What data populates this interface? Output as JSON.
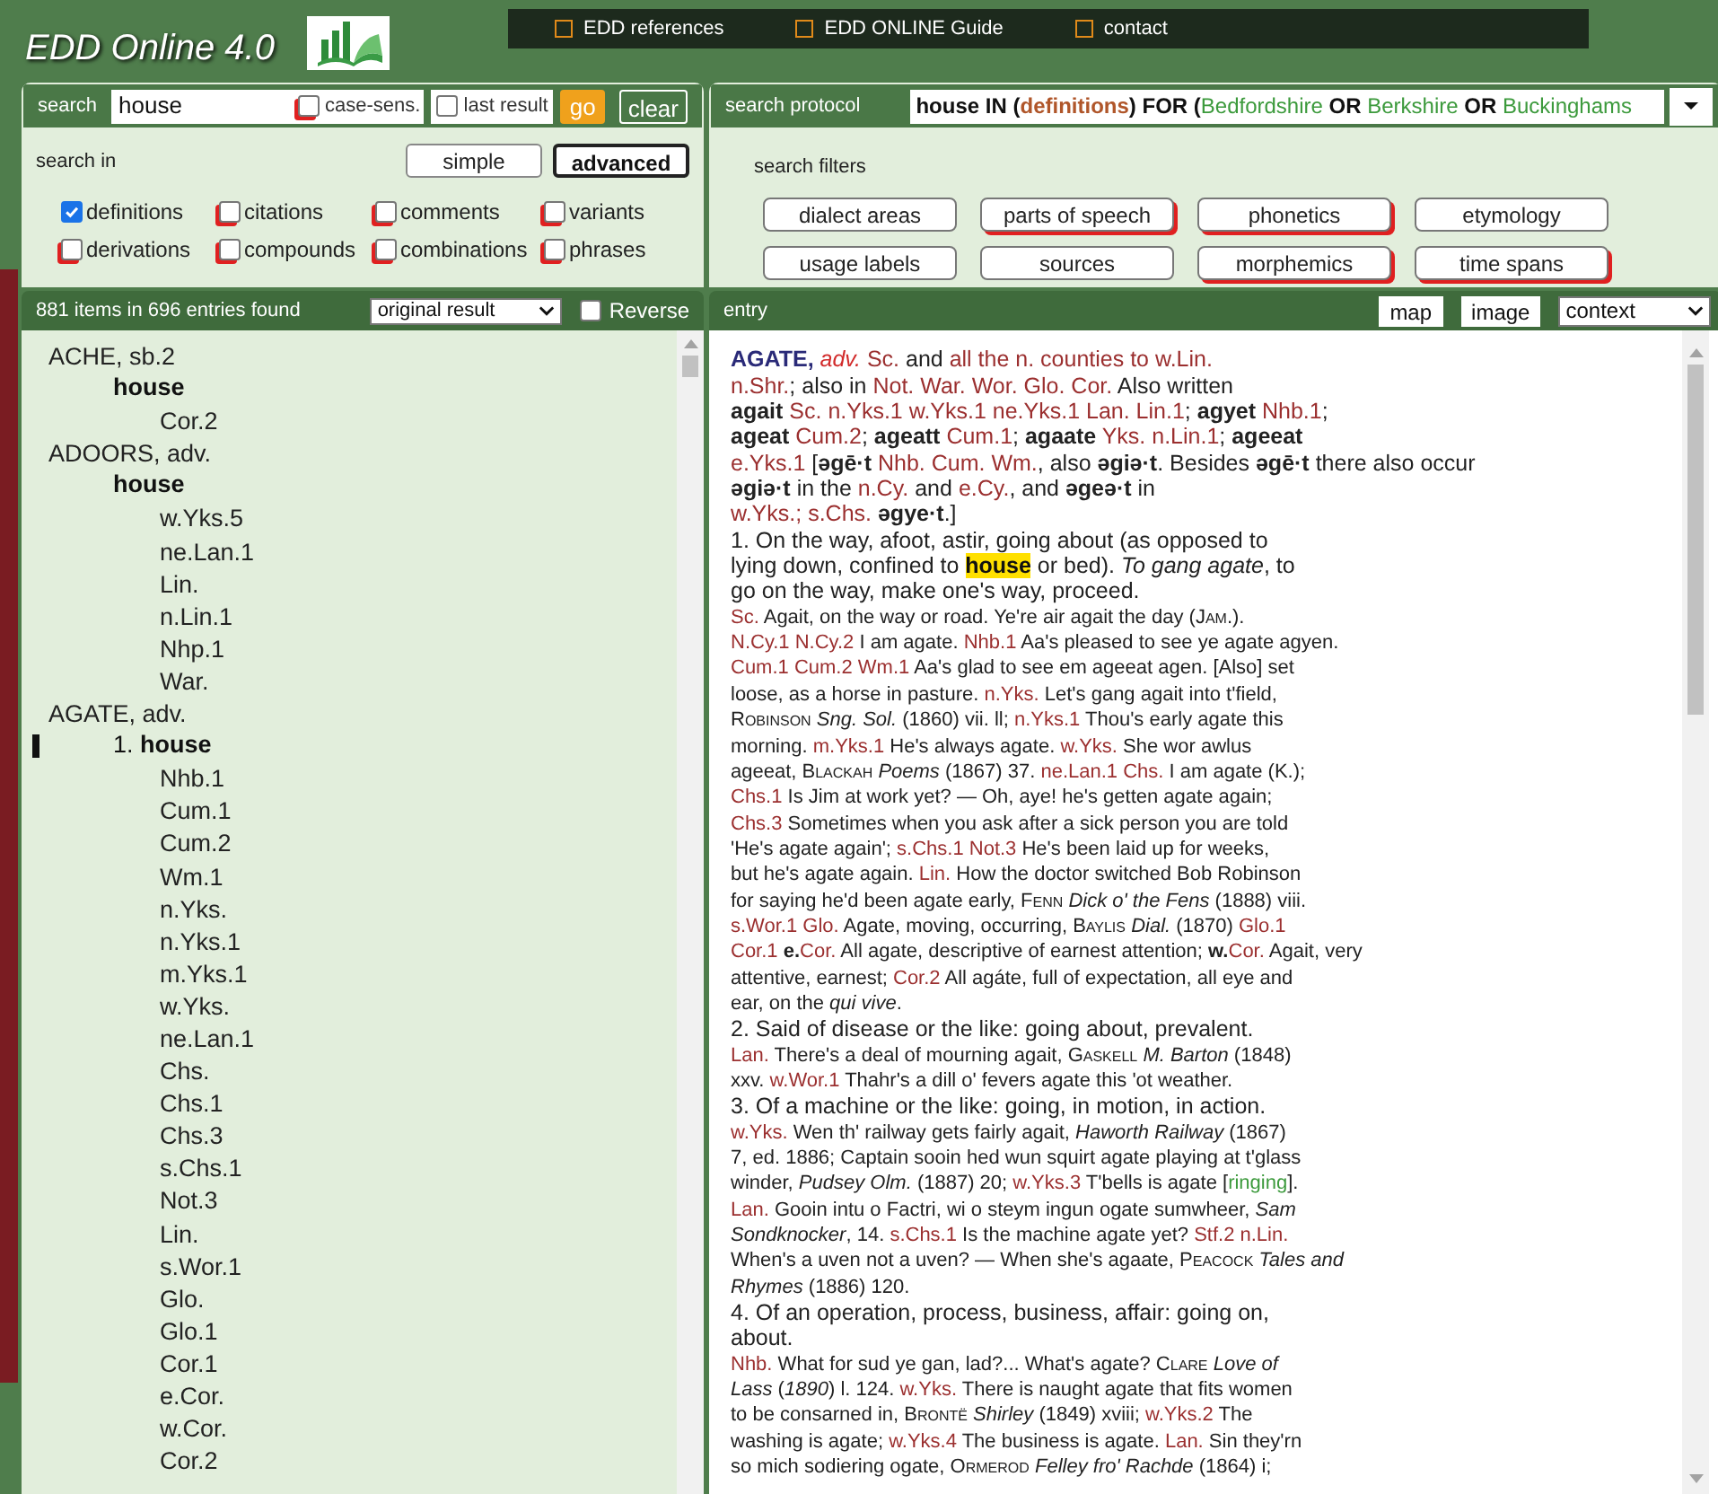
{
  "app": {
    "title": "EDD Online 4.0"
  },
  "top_menu": [
    {
      "label": "EDD references"
    },
    {
      "label": "EDD ONLINE Guide"
    },
    {
      "label": "contact"
    }
  ],
  "search": {
    "label": "search",
    "value": "house",
    "case_sens": {
      "label": "case-sens.",
      "checked": false
    },
    "last_result": {
      "label": "last result",
      "checked": false
    },
    "go": "go",
    "clear": "clear"
  },
  "search_in": {
    "label": "search in",
    "modes": [
      {
        "label": "simple",
        "selected": false
      },
      {
        "label": "advanced",
        "selected": true
      }
    ],
    "options": [
      {
        "label": "definitions",
        "checked": true
      },
      {
        "label": "citations",
        "checked": false
      },
      {
        "label": "comments",
        "checked": false
      },
      {
        "label": "variants",
        "checked": false
      },
      {
        "label": "derivations",
        "checked": false
      },
      {
        "label": "compounds",
        "checked": false
      },
      {
        "label": "combinations",
        "checked": false
      },
      {
        "label": "phrases",
        "checked": false
      }
    ]
  },
  "protocol": {
    "label": "search protocol",
    "segs": [
      {
        "kind": "b",
        "text": "house IN ("
      },
      {
        "kind": "o",
        "text": "definitions"
      },
      {
        "kind": "b",
        "text": ") FOR ("
      },
      {
        "kind": "g",
        "text": "Bedfordshire"
      },
      {
        "kind": "b",
        "text": " OR "
      },
      {
        "kind": "g",
        "text": "Berkshire"
      },
      {
        "kind": "b",
        "text": " OR "
      },
      {
        "kind": "g",
        "text": "Buckinghams"
      }
    ]
  },
  "filters": {
    "label": "search filters",
    "buttons": [
      {
        "label": "dialect areas",
        "active": false
      },
      {
        "label": "parts of speech",
        "active": true
      },
      {
        "label": "phonetics",
        "active": true
      },
      {
        "label": "etymology",
        "active": false
      },
      {
        "label": "usage labels",
        "active": false
      },
      {
        "label": "sources",
        "active": false
      },
      {
        "label": "morphemics",
        "active": true
      },
      {
        "label": "time spans",
        "active": true
      }
    ]
  },
  "results": {
    "summary": "881 items in 696 entries found",
    "order": "original result",
    "reverse": {
      "label": "Reverse",
      "checked": false
    }
  },
  "tree": [
    {
      "label": "ACHE, sb.2",
      "children": [
        {
          "label": "house",
          "selected": false,
          "children": [
            {
              "label": "Cor.2"
            }
          ]
        }
      ]
    },
    {
      "label": "ADOORS, adv.",
      "children": [
        {
          "label": "house",
          "selected": false,
          "children": [
            {
              "label": "w.Yks.5"
            },
            {
              "label": "ne.Lan.1"
            },
            {
              "label": "Lin."
            },
            {
              "label": "n.Lin.1"
            },
            {
              "label": "Nhp.1"
            },
            {
              "label": "War."
            }
          ]
        }
      ]
    },
    {
      "label": "AGATE, adv.",
      "children": [
        {
          "number": "1.",
          "label": "house",
          "selected": true,
          "children": [
            {
              "label": "Nhb.1"
            },
            {
              "label": "Cum.1"
            },
            {
              "label": "Cum.2"
            },
            {
              "label": "Wm.1"
            },
            {
              "label": "n.Yks."
            },
            {
              "label": "n.Yks.1"
            },
            {
              "label": "m.Yks.1"
            },
            {
              "label": "w.Yks."
            },
            {
              "label": "ne.Lan.1"
            },
            {
              "label": "Chs."
            },
            {
              "label": "Chs.1"
            },
            {
              "label": "Chs.3"
            },
            {
              "label": "s.Chs.1"
            },
            {
              "label": "Not.3"
            },
            {
              "label": "Lin."
            },
            {
              "label": "s.Wor.1"
            },
            {
              "label": "Glo."
            },
            {
              "label": "Glo.1"
            },
            {
              "label": "Cor.1"
            },
            {
              "label": "e.Cor."
            },
            {
              "label": "w.Cor."
            },
            {
              "label": "Cor.2"
            }
          ]
        }
      ]
    }
  ],
  "entry_bar": {
    "label": "entry",
    "buttons": [
      "map",
      "image"
    ],
    "view": "context"
  },
  "entry": [
    {
      "kind": "sense",
      "segs": [
        {
          "kind": "h",
          "text": "AGATE,"
        },
        {
          "kind": "a",
          "text": " adv."
        },
        {
          "kind": "r",
          "text": " Sc."
        },
        {
          "kind": "n",
          "text": " and "
        },
        {
          "kind": "r",
          "text": "all the n. counties to w.Lin."
        }
      ]
    },
    {
      "kind": "sense",
      "segs": [
        {
          "kind": "r",
          "text": "n.Shr."
        },
        {
          "kind": "n",
          "text": "; also in "
        },
        {
          "kind": "r",
          "text": "Not. War. Wor. Glo. Cor."
        },
        {
          "kind": "n",
          "text": " Also written"
        }
      ]
    },
    {
      "kind": "sense",
      "segs": [
        {
          "kind": "n",
          "text": "**agait**"
        },
        {
          "kind": "r",
          "text": " Sc. n.Yks.1 w.Yks.1 ne.Yks.1 Lan. Lin.1"
        },
        {
          "kind": "n",
          "text": "; **agyet**"
        },
        {
          "kind": "r",
          "text": " Nhb.1"
        },
        {
          "kind": "n",
          "text": ";"
        }
      ]
    },
    {
      "kind": "sense",
      "segs": [
        {
          "kind": "n",
          "text": "**ageat**"
        },
        {
          "kind": "r",
          "text": " Cum.2"
        },
        {
          "kind": "n",
          "text": "; **ageatt**"
        },
        {
          "kind": "r",
          "text": " Cum.1"
        },
        {
          "kind": "n",
          "text": "; **agaate**"
        },
        {
          "kind": "r",
          "text": " Yks. n.Lin.1"
        },
        {
          "kind": "n",
          "text": "; **ageeat**"
        }
      ]
    },
    {
      "kind": "sense",
      "segs": [
        {
          "kind": "r",
          "text": "e.Yks.1"
        },
        {
          "kind": "n",
          "text": " [**əgē·t**"
        },
        {
          "kind": "r",
          "text": " Nhb. Cum. Wm."
        },
        {
          "kind": "n",
          "text": ", also **əgiə·t**. Besides **əgē·t** there also occur"
        }
      ]
    },
    {
      "kind": "sense",
      "segs": [
        {
          "kind": "n",
          "text": "**əgiə·t** in the "
        },
        {
          "kind": "r",
          "text": "n.Cy."
        },
        {
          "kind": "n",
          "text": " and "
        },
        {
          "kind": "r",
          "text": "e.Cy."
        },
        {
          "kind": "n",
          "text": ", and **əgeə·t** in"
        }
      ]
    },
    {
      "kind": "sense",
      "segs": [
        {
          "kind": "r",
          "text": "w.Yks.; s.Chs."
        },
        {
          "kind": "n",
          "text": " **əgye·t**.]"
        }
      ]
    },
    {
      "kind": "sense",
      "segs": [
        {
          "kind": "n",
          "text": "1. On the way, afoot, astir, going about (as opposed to"
        }
      ]
    },
    {
      "kind": "sense",
      "segs": [
        {
          "kind": "n",
          "text": "lying down, confined to "
        },
        {
          "kind": "hl",
          "text": "house"
        },
        {
          "kind": "n",
          "text": " or bed). *To gang agate*, to"
        }
      ]
    },
    {
      "kind": "sense",
      "segs": [
        {
          "kind": "n",
          "text": "go on the way, make one's way, proceed."
        }
      ]
    },
    {
      "kind": "quote",
      "segs": [
        {
          "kind": "r",
          "text": "Sc."
        },
        {
          "kind": "n",
          "text": " Agait, on the way or road. Ye're air agait the day ("
        },
        {
          "kind": "sc",
          "text": "Jam."
        },
        {
          "kind": "n",
          "text": ")."
        }
      ]
    },
    {
      "kind": "quote",
      "segs": [
        {
          "kind": "r",
          "text": "N.Cy.1 N.Cy.2"
        },
        {
          "kind": "n",
          "text": " I am agate. "
        },
        {
          "kind": "r",
          "text": "Nhb.1"
        },
        {
          "kind": "n",
          "text": " Aa's pleased to see ye agate agyen."
        }
      ]
    },
    {
      "kind": "quote",
      "segs": [
        {
          "kind": "r",
          "text": "Cum.1 Cum.2 Wm.1"
        },
        {
          "kind": "n",
          "text": " Aa's glad to see em ageeat agen. [Also] set"
        }
      ]
    },
    {
      "kind": "quote",
      "segs": [
        {
          "kind": "n",
          "text": "loose, as a horse in pasture. "
        },
        {
          "kind": "r",
          "text": "n.Yks."
        },
        {
          "kind": "n",
          "text": " Let's gang agait into t'field,"
        }
      ]
    },
    {
      "kind": "quote",
      "segs": [
        {
          "kind": "sc",
          "text": "Robinson"
        },
        {
          "kind": "n",
          "text": " *Sng. Sol.* (1860) vii. ll; "
        },
        {
          "kind": "r",
          "text": "n.Yks.1"
        },
        {
          "kind": "n",
          "text": " Thou's early agate this"
        }
      ]
    },
    {
      "kind": "quote",
      "segs": [
        {
          "kind": "n",
          "text": "morning. "
        },
        {
          "kind": "r",
          "text": "m.Yks.1"
        },
        {
          "kind": "n",
          "text": " He's always agate. "
        },
        {
          "kind": "r",
          "text": "w.Yks."
        },
        {
          "kind": "n",
          "text": " She wor awlus"
        }
      ]
    },
    {
      "kind": "quote",
      "segs": [
        {
          "kind": "n",
          "text": "ageeat, "
        },
        {
          "kind": "sc",
          "text": "Blackah"
        },
        {
          "kind": "n",
          "text": " *Poems* (1867) 37. "
        },
        {
          "kind": "r",
          "text": "ne.Lan.1 Chs."
        },
        {
          "kind": "n",
          "text": " I am agate (K.);"
        }
      ]
    },
    {
      "kind": "quote",
      "segs": [
        {
          "kind": "r",
          "text": "Chs.1"
        },
        {
          "kind": "n",
          "text": " Is Jim at work yet? — Oh, aye! he's getten agate again;"
        }
      ]
    },
    {
      "kind": "quote",
      "segs": [
        {
          "kind": "r",
          "text": "Chs.3"
        },
        {
          "kind": "n",
          "text": " Sometimes when you ask after a sick person you are told"
        }
      ]
    },
    {
      "kind": "quote",
      "segs": [
        {
          "kind": "n",
          "text": "'He's agate again'; "
        },
        {
          "kind": "r",
          "text": "s.Chs.1 Not.3"
        },
        {
          "kind": "n",
          "text": " He's been laid up for weeks,"
        }
      ]
    },
    {
      "kind": "quote",
      "segs": [
        {
          "kind": "n",
          "text": "but he's agate again. "
        },
        {
          "kind": "r",
          "text": "Lin."
        },
        {
          "kind": "n",
          "text": " How the doctor switched Bob Robinson"
        }
      ]
    },
    {
      "kind": "quote",
      "segs": [
        {
          "kind": "n",
          "text": "for saying he'd been agate early, "
        },
        {
          "kind": "sc",
          "text": "Fenn"
        },
        {
          "kind": "n",
          "text": " *Dick o' the Fens* (1888) viii."
        }
      ]
    },
    {
      "kind": "quote",
      "segs": [
        {
          "kind": "r",
          "text": "s.Wor.1 Glo."
        },
        {
          "kind": "n",
          "text": " Agate, moving, occurring, "
        },
        {
          "kind": "sc",
          "text": "Baylis"
        },
        {
          "kind": "n",
          "text": " *Dial.* (1870) "
        },
        {
          "kind": "r",
          "text": "Glo.1"
        }
      ]
    },
    {
      "kind": "quote",
      "segs": [
        {
          "kind": "r",
          "text": "Cor.1"
        },
        {
          "kind": "n",
          "text": " **e.**"
        },
        {
          "kind": "r",
          "text": "Cor."
        },
        {
          "kind": "n",
          "text": " All agate, descriptive of earnest attention; **w.**"
        },
        {
          "kind": "r",
          "text": "Cor."
        },
        {
          "kind": "n",
          "text": " Agait, very"
        }
      ]
    },
    {
      "kind": "quote",
      "segs": [
        {
          "kind": "n",
          "text": "attentive, earnest; "
        },
        {
          "kind": "r",
          "text": "Cor.2"
        },
        {
          "kind": "n",
          "text": " All agáte, full of expectation, all eye and"
        }
      ]
    },
    {
      "kind": "quote",
      "segs": [
        {
          "kind": "n",
          "text": "ear, on the *qui vive*."
        }
      ]
    },
    {
      "kind": "sense",
      "segs": [
        {
          "kind": "n",
          "text": "2. Said of disease or the like: going about, prevalent."
        }
      ]
    },
    {
      "kind": "quote",
      "segs": [
        {
          "kind": "r",
          "text": "Lan."
        },
        {
          "kind": "n",
          "text": " There's a deal of mourning agait, "
        },
        {
          "kind": "sc",
          "text": "Gaskell"
        },
        {
          "kind": "n",
          "text": " *M. Barton* (1848)"
        }
      ]
    },
    {
      "kind": "quote",
      "segs": [
        {
          "kind": "n",
          "text": "xxv. "
        },
        {
          "kind": "r",
          "text": "w.Wor.1"
        },
        {
          "kind": "n",
          "text": " Thahr's a dill o' fevers agate this 'ot weather."
        }
      ]
    },
    {
      "kind": "sense",
      "segs": [
        {
          "kind": "n",
          "text": "3. Of a machine or the like: going, in motion, in action."
        }
      ]
    },
    {
      "kind": "quote",
      "segs": [
        {
          "kind": "r",
          "text": "w.Yks."
        },
        {
          "kind": "n",
          "text": " Wen th' railway gets fairly agait, *Haworth Railway* (1867)"
        }
      ]
    },
    {
      "kind": "quote",
      "segs": [
        {
          "kind": "n",
          "text": "7, ed. 1886; Captain sooin hed wun squirt agate playing at t'glass"
        }
      ]
    },
    {
      "kind": "quote",
      "segs": [
        {
          "kind": "n",
          "text": "winder, *Pudsey Olm.* (1887) 20; "
        },
        {
          "kind": "r",
          "text": "w.Yks.3"
        },
        {
          "kind": "n",
          "text": " T'bells is agate ["
        },
        {
          "kind": "g",
          "text": "ringing"
        },
        {
          "kind": "n",
          "text": "]."
        }
      ]
    },
    {
      "kind": "quote",
      "segs": [
        {
          "kind": "r",
          "text": "Lan."
        },
        {
          "kind": "n",
          "text": " Gooin intu o Factri, wi o steym ingun ogate sumwheer, *Sam*"
        }
      ]
    },
    {
      "kind": "quote",
      "segs": [
        {
          "kind": "n",
          "text": "*Sondknocker*, 14. "
        },
        {
          "kind": "r",
          "text": "s.Chs.1"
        },
        {
          "kind": "n",
          "text": " Is the machine agate yet? "
        },
        {
          "kind": "r",
          "text": "Stf.2 n.Lin."
        }
      ]
    },
    {
      "kind": "quote",
      "segs": [
        {
          "kind": "n",
          "text": "When's a uven not a uven? — When she's agaate, "
        },
        {
          "kind": "sc",
          "text": "Peacock"
        },
        {
          "kind": "n",
          "text": " *Tales and*"
        }
      ]
    },
    {
      "kind": "quote",
      "segs": [
        {
          "kind": "n",
          "text": "*Rhymes* (1886) 120."
        }
      ]
    },
    {
      "kind": "sense",
      "segs": [
        {
          "kind": "n",
          "text": "4. Of an operation, process, business, affair: going on,"
        }
      ]
    },
    {
      "kind": "sense",
      "segs": [
        {
          "kind": "n",
          "text": "about."
        }
      ]
    },
    {
      "kind": "quote",
      "segs": [
        {
          "kind": "r",
          "text": "Nhb."
        },
        {
          "kind": "n",
          "text": " What for sud ye gan, lad?... What's agate? "
        },
        {
          "kind": "sc",
          "text": "Clare"
        },
        {
          "kind": "n",
          "text": " *Love of*"
        }
      ]
    },
    {
      "kind": "quote",
      "segs": [
        {
          "kind": "n",
          "text": "*Lass* (*1890*) l. 124. "
        },
        {
          "kind": "r",
          "text": "w.Yks."
        },
        {
          "kind": "n",
          "text": " There is naught agate that fits women"
        }
      ]
    },
    {
      "kind": "quote",
      "segs": [
        {
          "kind": "n",
          "text": "to be consarned in, "
        },
        {
          "kind": "sc",
          "text": "Brontë"
        },
        {
          "kind": "n",
          "text": " *Shirley* (1849) xviii; "
        },
        {
          "kind": "r",
          "text": "w.Yks.2"
        },
        {
          "kind": "n",
          "text": " The"
        }
      ]
    },
    {
      "kind": "quote",
      "segs": [
        {
          "kind": "n",
          "text": "washing is agate; "
        },
        {
          "kind": "r",
          "text": "w.Yks.4"
        },
        {
          "kind": "n",
          "text": " The business is agate. "
        },
        {
          "kind": "r",
          "text": "Lan."
        },
        {
          "kind": "n",
          "text": " Sin they'rn"
        }
      ]
    },
    {
      "kind": "quote",
      "segs": [
        {
          "kind": "n",
          "text": "so mich sodiering ogate, "
        },
        {
          "kind": "sc",
          "text": "Ormerod"
        },
        {
          "kind": "n",
          "text": " *Felley fro' Rachde* (1864) i;"
        }
      ]
    }
  ]
}
